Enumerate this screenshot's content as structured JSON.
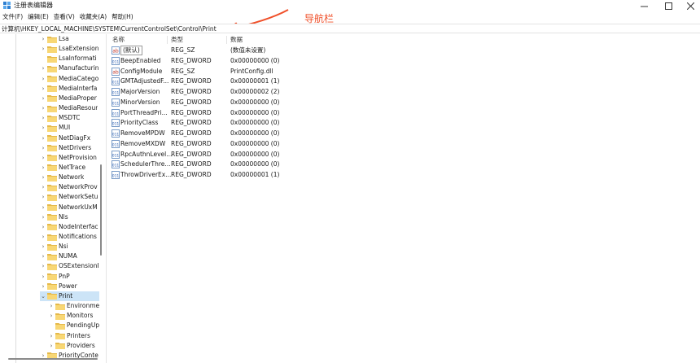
{
  "window": {
    "title": "注册表编辑器",
    "controls": {
      "minimize": "—",
      "maximize": "☐",
      "close": "✕"
    }
  },
  "menu": [
    "文件(F)",
    "编辑(E)",
    "查看(V)",
    "收藏夹(A)",
    "帮助(H)"
  ],
  "annotation": {
    "text": "导航栏",
    "color": "#f0502a"
  },
  "address": "计算机\\HKEY_LOCAL_MACHINE\\SYSTEM\\CurrentControlSet\\Control\\Print",
  "tree": [
    {
      "label": "Lsa",
      "level": 1,
      "expand": "›"
    },
    {
      "label": "LsaExtension",
      "level": 1,
      "expand": "›"
    },
    {
      "label": "LsaInformati",
      "level": 1,
      "expand": ""
    },
    {
      "label": "Manufacturin",
      "level": 1,
      "expand": "›"
    },
    {
      "label": "MediaCatego",
      "level": 1,
      "expand": "›"
    },
    {
      "label": "MediaInterfa",
      "level": 1,
      "expand": "›"
    },
    {
      "label": "MediaProper",
      "level": 1,
      "expand": "›"
    },
    {
      "label": "MediaResour",
      "level": 1,
      "expand": "›"
    },
    {
      "label": "MSDTC",
      "level": 1,
      "expand": "›"
    },
    {
      "label": "MUI",
      "level": 1,
      "expand": "›"
    },
    {
      "label": "NetDiagFx",
      "level": 1,
      "expand": "›"
    },
    {
      "label": "NetDrivers",
      "level": 1,
      "expand": "›"
    },
    {
      "label": "NetProvision",
      "level": 1,
      "expand": "›"
    },
    {
      "label": "NetTrace",
      "level": 1,
      "expand": "›"
    },
    {
      "label": "Network",
      "level": 1,
      "expand": "›"
    },
    {
      "label": "NetworkProv",
      "level": 1,
      "expand": "›"
    },
    {
      "label": "NetworkSetu",
      "level": 1,
      "expand": "›"
    },
    {
      "label": "NetworkUxM",
      "level": 1,
      "expand": "›"
    },
    {
      "label": "Nls",
      "level": 1,
      "expand": "›"
    },
    {
      "label": "NodeInterfac",
      "level": 1,
      "expand": "›"
    },
    {
      "label": "Notifications",
      "level": 1,
      "expand": "›"
    },
    {
      "label": "Nsi",
      "level": 1,
      "expand": "›"
    },
    {
      "label": "NUMA",
      "level": 1,
      "expand": "›"
    },
    {
      "label": "OSExtensionI",
      "level": 1,
      "expand": "›"
    },
    {
      "label": "PnP",
      "level": 1,
      "expand": "›"
    },
    {
      "label": "Power",
      "level": 1,
      "expand": "›"
    },
    {
      "label": "Print",
      "level": 1,
      "expand": "⌄",
      "selected": true
    },
    {
      "label": "Environme",
      "level": 2,
      "expand": "›"
    },
    {
      "label": "Monitors",
      "level": 2,
      "expand": "›"
    },
    {
      "label": "PendingUp",
      "level": 2,
      "expand": ""
    },
    {
      "label": "Printers",
      "level": 2,
      "expand": "›"
    },
    {
      "label": "Providers",
      "level": 2,
      "expand": "›"
    },
    {
      "label": "PriorityConte",
      "level": 1,
      "expand": "›"
    }
  ],
  "columns": {
    "name": "名称",
    "type": "类型",
    "data": "数据"
  },
  "values": [
    {
      "icon": "string-value-icon",
      "name": "(默认)",
      "type": "REG_SZ",
      "data": "(数值未设置)"
    },
    {
      "icon": "binary-value-icon",
      "name": "BeepEnabled",
      "type": "REG_DWORD",
      "data": "0x00000000 (0)"
    },
    {
      "icon": "string-value-icon",
      "name": "ConfigModule",
      "type": "REG_SZ",
      "data": "PrintConfig.dll"
    },
    {
      "icon": "binary-value-icon",
      "name": "GMTAdjustedF...",
      "type": "REG_DWORD",
      "data": "0x00000001 (1)"
    },
    {
      "icon": "binary-value-icon",
      "name": "MajorVersion",
      "type": "REG_DWORD",
      "data": "0x00000002 (2)"
    },
    {
      "icon": "binary-value-icon",
      "name": "MinorVersion",
      "type": "REG_DWORD",
      "data": "0x00000000 (0)"
    },
    {
      "icon": "binary-value-icon",
      "name": "PortThreadPri...",
      "type": "REG_DWORD",
      "data": "0x00000000 (0)"
    },
    {
      "icon": "binary-value-icon",
      "name": "PriorityClass",
      "type": "REG_DWORD",
      "data": "0x00000000 (0)"
    },
    {
      "icon": "binary-value-icon",
      "name": "RemoveMPDW",
      "type": "REG_DWORD",
      "data": "0x00000000 (0)"
    },
    {
      "icon": "binary-value-icon",
      "name": "RemoveMXDW",
      "type": "REG_DWORD",
      "data": "0x00000000 (0)"
    },
    {
      "icon": "binary-value-icon",
      "name": "RpcAuthnLevel...",
      "type": "REG_DWORD",
      "data": "0x00000000 (0)"
    },
    {
      "icon": "binary-value-icon",
      "name": "SchedulerThre...",
      "type": "REG_DWORD",
      "data": "0x00000000 (0)"
    },
    {
      "icon": "binary-value-icon",
      "name": "ThrowDriverEx...",
      "type": "REG_DWORD",
      "data": "0x00000001 (1)"
    }
  ]
}
